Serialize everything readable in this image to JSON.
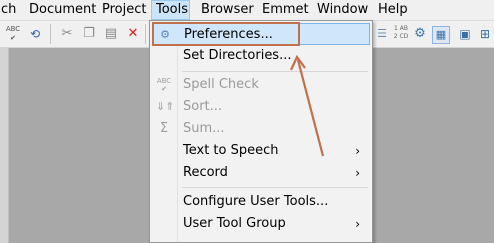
{
  "menubar": {
    "items": [
      {
        "label": "ch"
      },
      {
        "label": "Document"
      },
      {
        "label": "Project"
      },
      {
        "label": "Tools"
      },
      {
        "label": "Browser"
      },
      {
        "label": "Emmet"
      },
      {
        "label": "Window"
      },
      {
        "label": "Help"
      }
    ]
  },
  "toolbar": {
    "abc_label": "ABC",
    "abcd_label": "1 AB\n2 CD"
  },
  "tools_menu": {
    "items": [
      {
        "label": "Preferences...",
        "icon": "gear-icon"
      },
      {
        "label": "Set Directories..."
      },
      {
        "label": "Spell Check",
        "icon": "spell-check-icon"
      },
      {
        "label": "Sort...",
        "icon": "sort-icon"
      },
      {
        "label": "Sum...",
        "icon": "sum-icon"
      },
      {
        "label": "Text to Speech",
        "submenu": "›"
      },
      {
        "label": "Record",
        "submenu": "›"
      },
      {
        "label": "Configure User Tools..."
      },
      {
        "label": "User Tool Group",
        "submenu": "›"
      }
    ],
    "highlight_color": "#cfe6fb",
    "annotation_color": "#c0704a"
  }
}
